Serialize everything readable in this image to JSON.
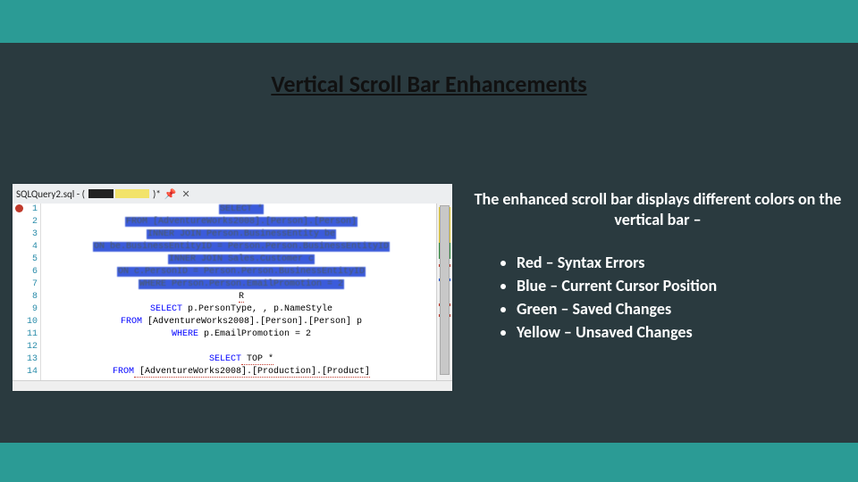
{
  "title": "Vertical Scroll Bar Enhancements",
  "editor": {
    "tab_label": "SQLQuery2.sql - (",
    "tab_suffix": ")*",
    "close_glyph": "✕",
    "pin_glyph": "📌",
    "split_glyph": "⇳",
    "lines": {
      "l1": "SELECT *",
      "l2": "FROM [AdventureWorks2008].[Person].[Person]",
      "l3": "INNER JOIN Person.BusinessEntity be",
      "l4": "ON be.BusinessEntityID = Person.Person.BusinessEntityID",
      "l5": "INNER JOIN Sales.Customer c",
      "l6": "ON c.PersonID = Person.Person.BusinessEntityID",
      "l7": "WHERE Person.Person.EmailPromotion = 2",
      "l8": "R",
      "l9a": "SELECT",
      "l9b": " p.PersonType, , p.NameStyle",
      "l10a": "FROM",
      "l10b": " [AdventureWorks2008].[Person].[Person] p",
      "l11a": "WHERE",
      "l11b": " p.EmailPromotion = 2",
      "l12": "",
      "l13a": "SELECT",
      "l13b": "  TOP *",
      "l14a": "FROM",
      "l14b": " [AdventureWorks2008].[Production].[Product]"
    },
    "line_numbers": [
      "1",
      "2",
      "3",
      "4",
      "5",
      "6",
      "7",
      "8",
      "9",
      "10",
      "11",
      "12",
      "13",
      "14"
    ]
  },
  "info": {
    "description": "The enhanced scroll bar displays different colors on the vertical bar –",
    "items": [
      "Red    –   Syntax Errors",
      "Blue   –   Current Cursor Position",
      "Green –   Saved Changes",
      "Yellow –   Unsaved Changes"
    ]
  },
  "colors": {
    "red": "#c0392b",
    "blue": "#1b4fd6",
    "green": "#2e8b3d",
    "yellow": "#e5c92b"
  }
}
